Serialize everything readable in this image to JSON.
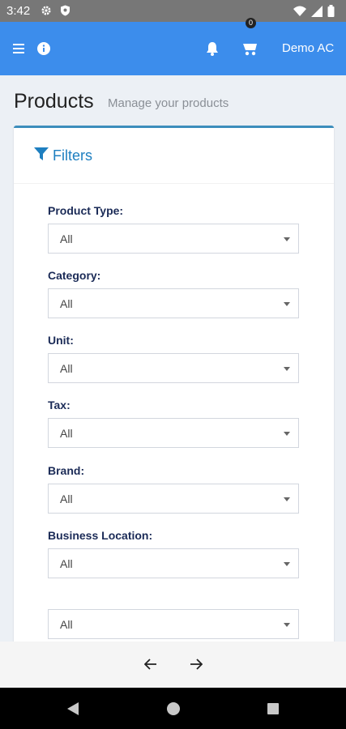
{
  "status_bar": {
    "time": "3:42",
    "icons_left": [
      "gear-icon",
      "shield-icon"
    ],
    "icons_right": [
      "wifi-icon",
      "signal-icon",
      "battery-icon"
    ]
  },
  "header": {
    "background": "#3c8dec",
    "cart_count": "0",
    "user_name": "Demo AC"
  },
  "page": {
    "title": "Products",
    "subtitle": "Manage your products"
  },
  "filters": {
    "title": "Filters",
    "fields": [
      {
        "label": "Product Type:",
        "value": "All"
      },
      {
        "label": "Category:",
        "value": "All"
      },
      {
        "label": "Unit:",
        "value": "All"
      },
      {
        "label": "Tax:",
        "value": "All"
      },
      {
        "label": "Brand:",
        "value": "All"
      },
      {
        "label": "Business Location:",
        "value": "All"
      },
      {
        "label": "",
        "value": "All"
      }
    ]
  },
  "colors": {
    "accent": "#3c8dbc",
    "filters_title": "#1e7fc0",
    "label": "#1b2b57"
  }
}
